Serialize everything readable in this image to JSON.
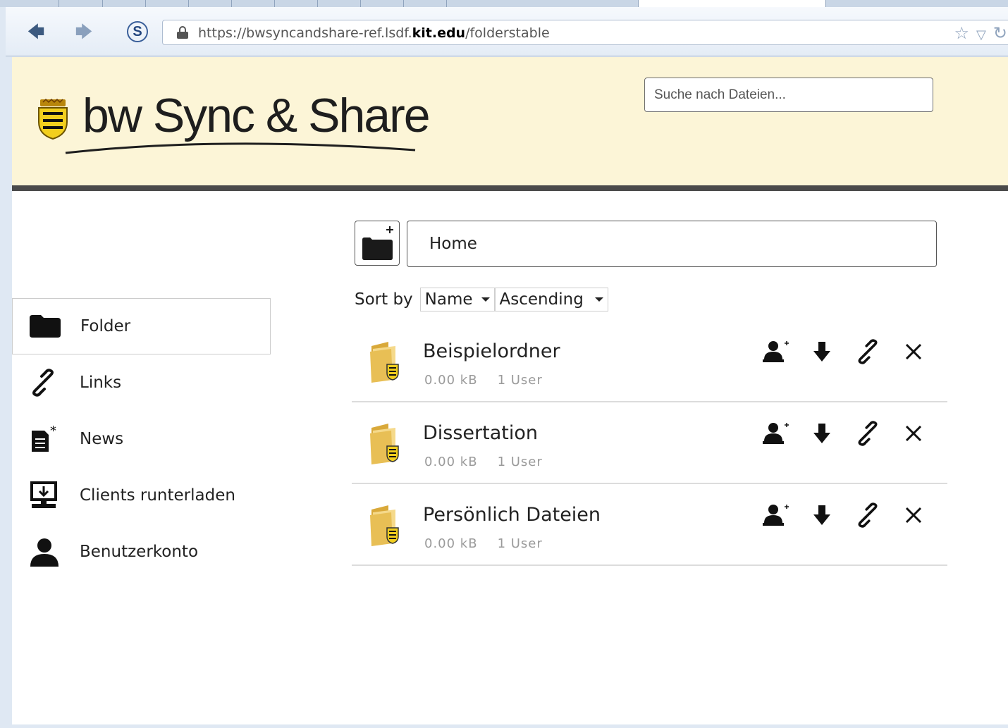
{
  "browser": {
    "url_prefix": "https://bwsyncandshare-ref.lsdf.",
    "url_domain": "kit.edu",
    "url_path": "/folderstable"
  },
  "header": {
    "logo_text": "bw Sync & Share",
    "search_placeholder": "Suche nach Dateien..."
  },
  "sidebar": {
    "items": [
      {
        "label": "Folder",
        "icon": "folder-icon",
        "active": true
      },
      {
        "label": "Links",
        "icon": "link-icon",
        "active": false
      },
      {
        "label": "News",
        "icon": "news-icon",
        "active": false
      },
      {
        "label": "Clients runterladen",
        "icon": "download-client-icon",
        "active": false
      },
      {
        "label": "Benutzerkonto",
        "icon": "user-icon",
        "active": false
      }
    ]
  },
  "main": {
    "breadcrumb": "Home",
    "sort": {
      "label": "Sort by",
      "field": "Name",
      "order": "Ascending"
    },
    "folders": [
      {
        "name": "Beispielordner",
        "size": "0.00 kB",
        "users": "1 User"
      },
      {
        "name": "Dissertation",
        "size": "0.00 kB",
        "users": "1 User"
      },
      {
        "name": "Persönlich Dateien",
        "size": "0.00 kB",
        "users": "1 User"
      }
    ],
    "row_action_icons": [
      "add-user-icon",
      "download-icon",
      "link-icon",
      "delete-icon"
    ]
  },
  "colors": {
    "header_bg": "#fcf5d7",
    "header_border": "#4a4a4a",
    "meta_text": "#9a9a9a"
  }
}
